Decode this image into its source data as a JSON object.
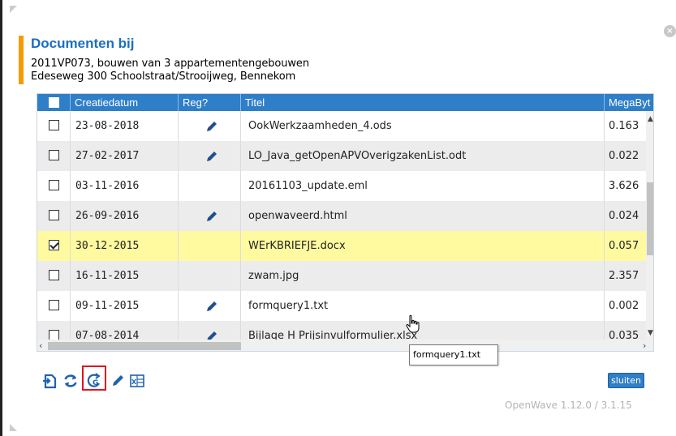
{
  "dialog": {
    "title": "Documenten bij",
    "subtitle_line1": "2011VP073, bouwen van 3 appartementengebouwen",
    "subtitle_line2": "Edeseweg 300 Schoolstraat/Strooijweg, Bennekom",
    "close_glyph": "×"
  },
  "table": {
    "columns": [
      "",
      "Creatiedatum",
      "Reg?",
      "Titel",
      "MegaByt"
    ],
    "rows": [
      {
        "checked": false,
        "date": "23-08-2018",
        "reg": true,
        "title": "OokWerkzaamheden_4.ods",
        "mb": "0.163"
      },
      {
        "checked": false,
        "date": "27-02-2017",
        "reg": true,
        "title": "LO_Java_getOpenAPVOverigzakenList.odt",
        "mb": "0.022"
      },
      {
        "checked": false,
        "date": "03-11-2016",
        "reg": false,
        "title": "20161103_update.eml",
        "mb": "3.626"
      },
      {
        "checked": false,
        "date": "26-09-2016",
        "reg": true,
        "title": "openwaveerd.html",
        "mb": "0.024"
      },
      {
        "checked": true,
        "date": "30-12-2015",
        "reg": false,
        "title": "WErKBRIEFJE.docx",
        "mb": "0.057"
      },
      {
        "checked": false,
        "date": "16-11-2015",
        "reg": false,
        "title": "zwam.jpg",
        "mb": "2.357"
      },
      {
        "checked": false,
        "date": "09-11-2015",
        "reg": true,
        "title": "formquery1.txt",
        "mb": "0.002"
      },
      {
        "checked": false,
        "date": "07-08-2014",
        "reg": true,
        "title": "Bijlage H Prijsinvulformulier.xlsx",
        "mb": "0.035"
      }
    ],
    "selected_row": 4
  },
  "tooltip": {
    "text": "formquery1.txt"
  },
  "toolbar": {
    "icons": [
      "import-icon",
      "refresh-icon",
      "register-icon",
      "edit-icon",
      "excel-icon"
    ],
    "highlighted": "register-icon"
  },
  "buttons": {
    "close_label": "sluiten"
  },
  "footer": {
    "version": "OpenWave 1.12.0 / 3.1.15"
  },
  "colors": {
    "header_blue": "#2f7ec8",
    "title_blue": "#1a6fc0",
    "accent_orange": "#f59b00",
    "selected_row": "#fffaa0",
    "highlight_red": "#e0141e"
  }
}
